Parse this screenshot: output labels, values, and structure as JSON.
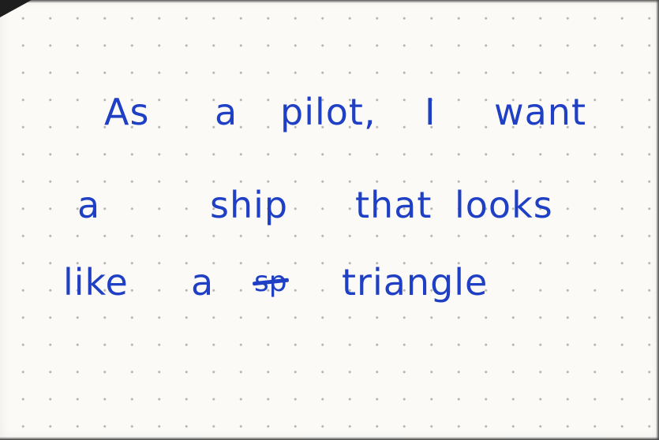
{
  "note": {
    "ink_color": "#1f3fc4",
    "paper_color": "#fbfaf7",
    "dot_color": "#b9b6ae",
    "lines": [
      {
        "words": [
          "As",
          "a",
          "pilot,",
          "I",
          "want"
        ]
      },
      {
        "words": [
          "a",
          "ship",
          "that",
          "looks"
        ]
      },
      {
        "words": [
          "like",
          "a",
          "sp",
          "triangle"
        ]
      }
    ],
    "struck_out": "sp"
  }
}
